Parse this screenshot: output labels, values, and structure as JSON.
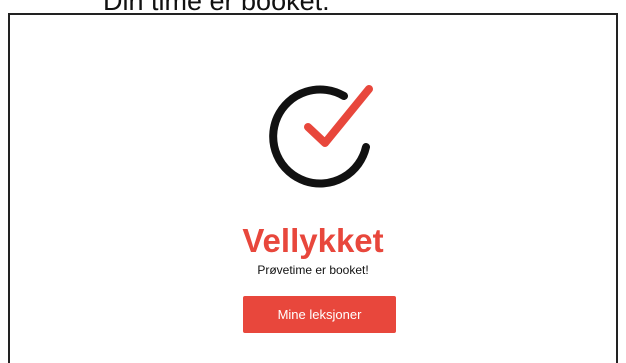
{
  "header": {
    "caption": "Din time er booket."
  },
  "success": {
    "icon": "check-circle-icon",
    "title": "Vellykket",
    "message": "Prøvetime er booket!",
    "button_label": "Mine leksjoner"
  },
  "colors": {
    "accent": "#e8473c",
    "icon_ring": "#111111",
    "text": "#111111",
    "background": "#ffffff"
  }
}
